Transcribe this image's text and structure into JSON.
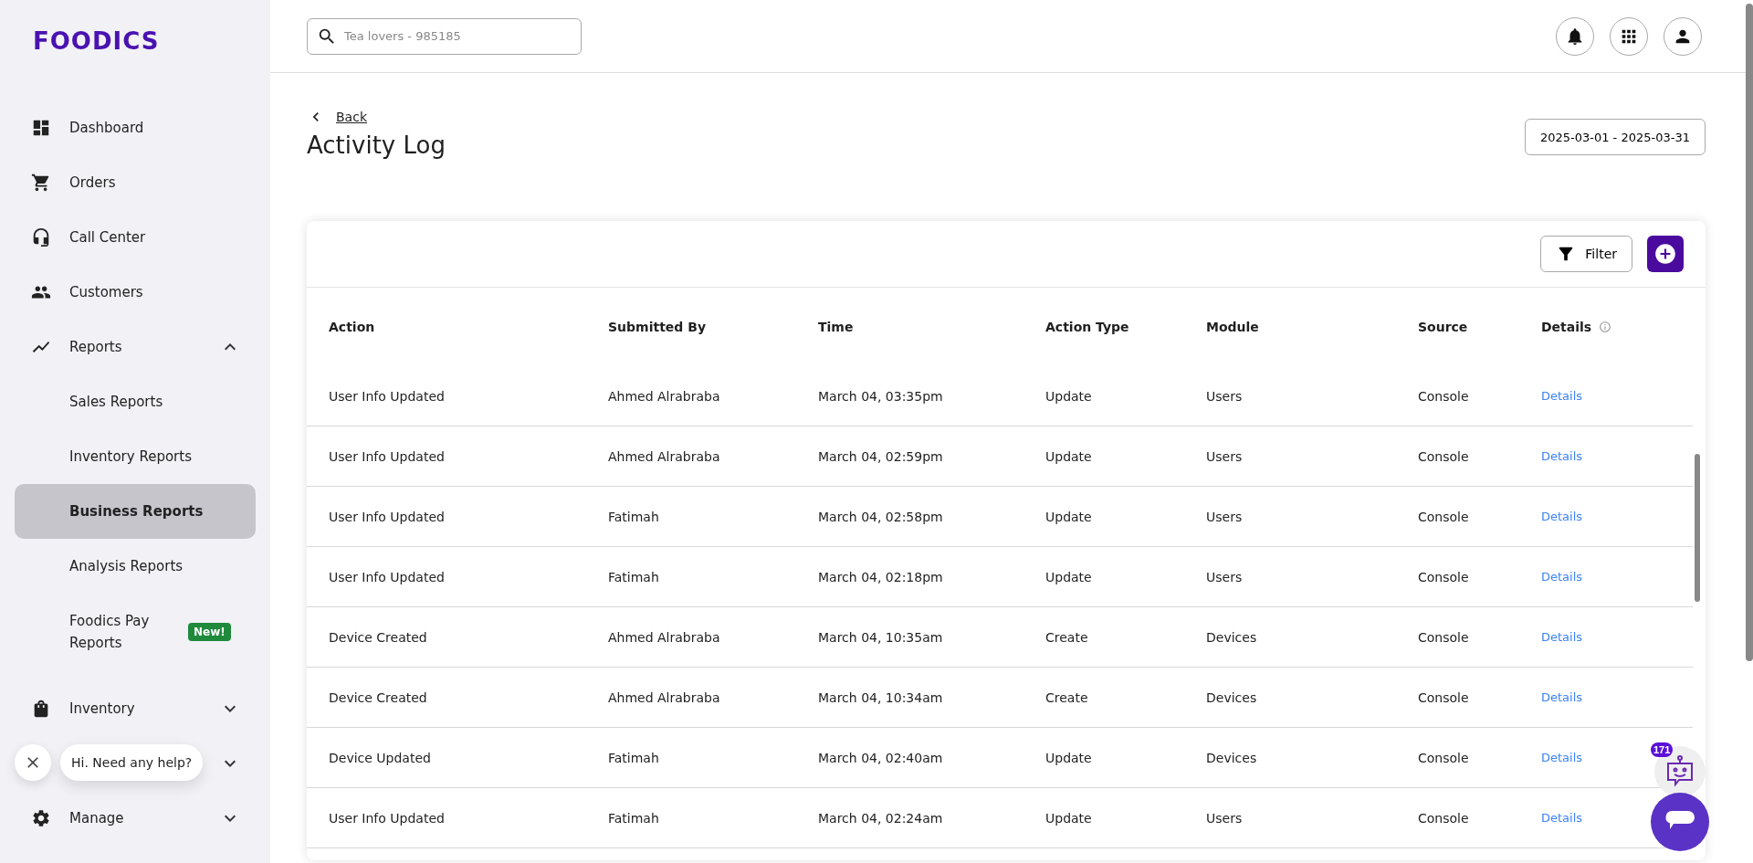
{
  "brand": {
    "logo": "FOODICS"
  },
  "sidebar": {
    "items": [
      {
        "kind": "link",
        "label": "Dashboard"
      },
      {
        "kind": "link",
        "label": "Orders"
      },
      {
        "kind": "link",
        "label": "Call Center"
      },
      {
        "kind": "link",
        "label": "Customers"
      },
      {
        "kind": "group",
        "label": "Reports",
        "expanded": true,
        "children": [
          {
            "label": "Sales Reports",
            "selected": false
          },
          {
            "label": "Inventory Reports",
            "selected": false
          },
          {
            "label": "Business Reports",
            "selected": true
          },
          {
            "label": "Analysis Reports",
            "selected": false
          },
          {
            "label": "Foodics Pay Reports",
            "selected": false,
            "badge": "New!"
          }
        ]
      },
      {
        "kind": "group",
        "label": "Inventory",
        "expanded": false
      },
      {
        "kind": "group",
        "expanded": false
      },
      {
        "kind": "group",
        "label": "Manage",
        "expanded": false
      }
    ]
  },
  "search": {
    "placeholder": "Tea lovers - 985185"
  },
  "back_link": "Back",
  "page_title": "Activity Log",
  "date_range": "2025-03-01 - 2025-03-31",
  "toolbar": {
    "filter_button": "Filter"
  },
  "table": {
    "columns": [
      "Action",
      "Submitted By",
      "Time",
      "Action Type",
      "Module",
      "Source",
      "Details"
    ],
    "rows": [
      {
        "action": "User Info Updated",
        "submitted_by": "Ahmed Alrabraba",
        "time": "March 04, 03:35pm",
        "action_type": "Update",
        "module": "Users",
        "source": "Console",
        "details": "Details"
      },
      {
        "action": "User Info Updated",
        "submitted_by": "Ahmed Alrabraba",
        "time": "March 04, 02:59pm",
        "action_type": "Update",
        "module": "Users",
        "source": "Console",
        "details": "Details"
      },
      {
        "action": "User Info Updated",
        "submitted_by": "Fatimah",
        "time": "March 04, 02:58pm",
        "action_type": "Update",
        "module": "Users",
        "source": "Console",
        "details": "Details"
      },
      {
        "action": "User Info Updated",
        "submitted_by": "Fatimah",
        "time": "March 04, 02:18pm",
        "action_type": "Update",
        "module": "Users",
        "source": "Console",
        "details": "Details"
      },
      {
        "action": "Device Created",
        "submitted_by": "Ahmed Alrabraba",
        "time": "March 04, 10:35am",
        "action_type": "Create",
        "module": "Devices",
        "source": "Console",
        "details": "Details"
      },
      {
        "action": "Device Created",
        "submitted_by": "Ahmed Alrabraba",
        "time": "March 04, 10:34am",
        "action_type": "Create",
        "module": "Devices",
        "source": "Console",
        "details": "Details"
      },
      {
        "action": "Device Updated",
        "submitted_by": "Fatimah",
        "time": "March 04, 02:40am",
        "action_type": "Update",
        "module": "Devices",
        "source": "Console",
        "details": "Details"
      },
      {
        "action": "User Info Updated",
        "submitted_by": "Fatimah",
        "time": "March 04, 02:24am",
        "action_type": "Update",
        "module": "Users",
        "source": "Console",
        "details": "Details"
      }
    ]
  },
  "help_bubble": "Hi. Need any help?",
  "chat": {
    "badge": "171"
  }
}
